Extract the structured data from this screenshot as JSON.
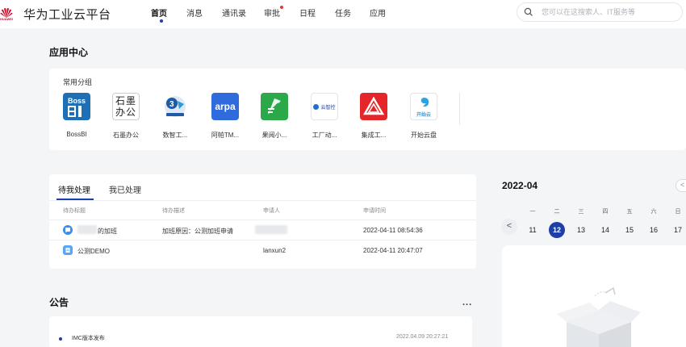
{
  "header": {
    "brand_logo_text": "HUAWEI",
    "app_title": "华为工业云平台",
    "nav": [
      {
        "label": "首页",
        "active": true
      },
      {
        "label": "消息"
      },
      {
        "label": "通讯录"
      },
      {
        "label": "审批",
        "badge": true
      },
      {
        "label": "日程"
      },
      {
        "label": "任务"
      },
      {
        "label": "应用"
      }
    ],
    "search": {
      "placeholder": "您可以在这搜索人、IT服务等",
      "icon": "search-icon"
    }
  },
  "app_center": {
    "title": "应用中心",
    "group_title": "常用分组",
    "apps": [
      {
        "name": "BossBI",
        "icon": "bossbi-icon",
        "icon_text": "Boss"
      },
      {
        "name": "石墨办公",
        "icon": "shimo-icon",
        "icon_text": "石墨办公"
      },
      {
        "name": "数智工...",
        "icon": "shuzhi-icon"
      },
      {
        "name": "阿帕TM...",
        "icon": "arpa-icon",
        "icon_text": "arpa"
      },
      {
        "name": "果阅小...",
        "icon": "guoyue-icon"
      },
      {
        "name": "工厂动...",
        "icon": "factory-icon",
        "icon_text": "云智控"
      },
      {
        "name": "集成工...",
        "icon": "jicheng-icon"
      },
      {
        "name": "开始云盘",
        "icon": "cloud-drive-icon",
        "icon_text": "开始云"
      }
    ]
  },
  "todo": {
    "tabs": [
      {
        "label": "待我处理",
        "active": true
      },
      {
        "label": "我已处理"
      }
    ],
    "columns": [
      "待办标题",
      "待办描述",
      "申请人",
      "申请时间"
    ],
    "rows": [
      {
        "title": "的加班",
        "desc": "加班原因：公测加班申请",
        "applicant": "",
        "time": "2022-04-11 08:54:36",
        "icon": "chat-icon"
      },
      {
        "title": "公测DEMO",
        "desc": "",
        "applicant": "lanxun2",
        "time": "2022-04-11 20:47:07",
        "icon": "doc-icon"
      }
    ]
  },
  "notice": {
    "title": "公告",
    "more": "...",
    "items": [
      {
        "text": "IMC版本发布",
        "date": "2022.04.09 20:27:21"
      }
    ]
  },
  "calendar": {
    "month": "2022-04",
    "weekdays": [
      "一",
      "二",
      "三",
      "四",
      "五",
      "六",
      "日"
    ],
    "days": [
      "11",
      "12",
      "13",
      "14",
      "15",
      "16",
      "17"
    ],
    "selected": "12",
    "prev": "<",
    "next": "<"
  },
  "colors": {
    "accent": "#1f3fa8",
    "badge": "#e53935",
    "brand": "#c8102e"
  }
}
